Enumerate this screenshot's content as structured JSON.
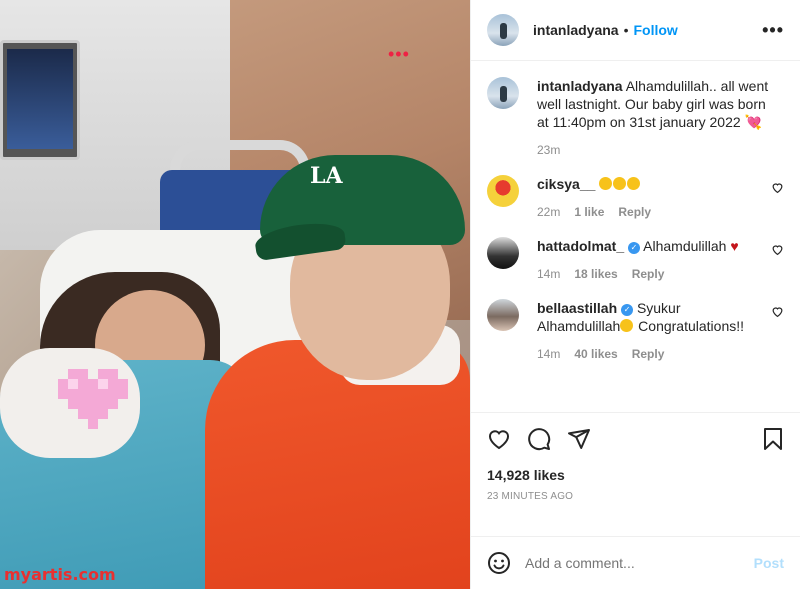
{
  "post": {
    "username": "intanladyana",
    "follow_label": "Follow",
    "more_label": "•••",
    "separator": "•"
  },
  "caption": {
    "username": "intanladyana",
    "text": "Alhamdulillah.. all went well lastnight. Our baby girl was born at 11:40pm on 31st january 2022",
    "emoji": "💘",
    "age": "23m"
  },
  "comments": [
    {
      "username": "ciksya__",
      "verified": false,
      "text": "",
      "emoji_count": 3,
      "age": "22m",
      "likes": "1 like",
      "reply": "Reply"
    },
    {
      "username": "hattadolmat_",
      "verified": true,
      "text": "Alhamdulillah",
      "heart": "♥",
      "age": "14m",
      "likes": "18 likes",
      "reply": "Reply"
    },
    {
      "username": "bellaastillah",
      "verified": true,
      "text_a": "Syukur",
      "text_b": "Alhamdulillah",
      "text_c": " Congratulations!!",
      "age": "14m",
      "likes": "40 likes",
      "reply": "Reply"
    }
  ],
  "stats": {
    "likes": "14,928 likes",
    "time": "23 MINUTES AGO"
  },
  "add_comment": {
    "placeholder": "Add a comment...",
    "post_label": "Post"
  },
  "photo": {
    "watermark": "myartis.com",
    "cap_logo": "LA",
    "dots": "•••"
  },
  "colors": {
    "link_blue": "#0095f6",
    "post_disabled": "#b2dffc",
    "meta_gray": "#8e8e8e",
    "verified_blue": "#3897f0"
  }
}
